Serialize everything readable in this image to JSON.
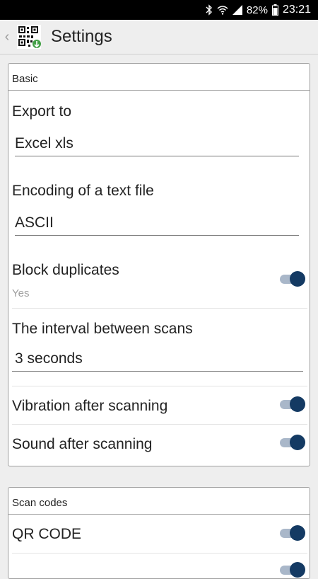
{
  "status_bar": {
    "battery": "82%",
    "time": "23:21"
  },
  "app_bar": {
    "title": "Settings"
  },
  "basic_section": {
    "header": "Basic",
    "export_to": {
      "title": "Export to",
      "value": "Excel xls"
    },
    "encoding": {
      "title": "Encoding of a text file",
      "value": "ASCII"
    },
    "block_duplicates": {
      "title": "Block duplicates",
      "summary": "Yes",
      "checked": true
    },
    "interval": {
      "title": "The interval between scans",
      "value": "3 seconds"
    },
    "vibration": {
      "title": "Vibration after scanning",
      "checked": true
    },
    "sound": {
      "title": "Sound after scanning",
      "checked": true
    }
  },
  "scan_codes_section": {
    "header": "Scan codes",
    "qr_code": {
      "title": "QR CODE",
      "checked": true
    }
  },
  "colors": {
    "toggle_thumb": "#143a63",
    "toggle_track": "#a9b7c9"
  }
}
